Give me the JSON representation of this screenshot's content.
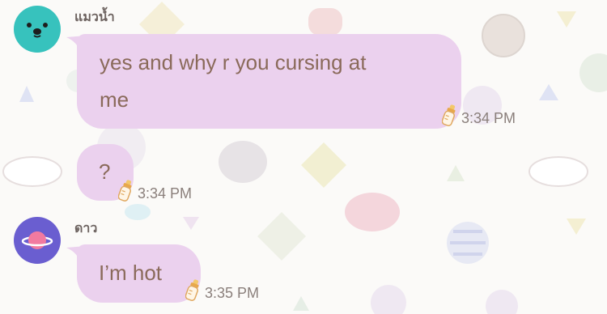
{
  "chat": {
    "messages": [
      {
        "sender": "แมวน้ำ",
        "avatar_icon": "seal-face-icon",
        "avatar_color": "#37c2bd",
        "text": "yes and why r you cursing at me",
        "line1": "yes and why r you cursing at",
        "line2": "me",
        "time": "3:34 PM",
        "status_icon": "baby-bottle-icon"
      },
      {
        "text": "?",
        "time": "3:34 PM",
        "status_icon": "baby-bottle-icon"
      },
      {
        "sender": "ดาว",
        "avatar_icon": "planet-icon",
        "avatar_color": "#6a5ed0",
        "text": "I’m hot",
        "time": "3:35 PM",
        "status_icon": "baby-bottle-icon"
      }
    ]
  },
  "theme": {
    "bubble_color": "#ebd1ee",
    "bubble_text_color": "#8a6a5a",
    "background_color": "#fbfaf8"
  }
}
